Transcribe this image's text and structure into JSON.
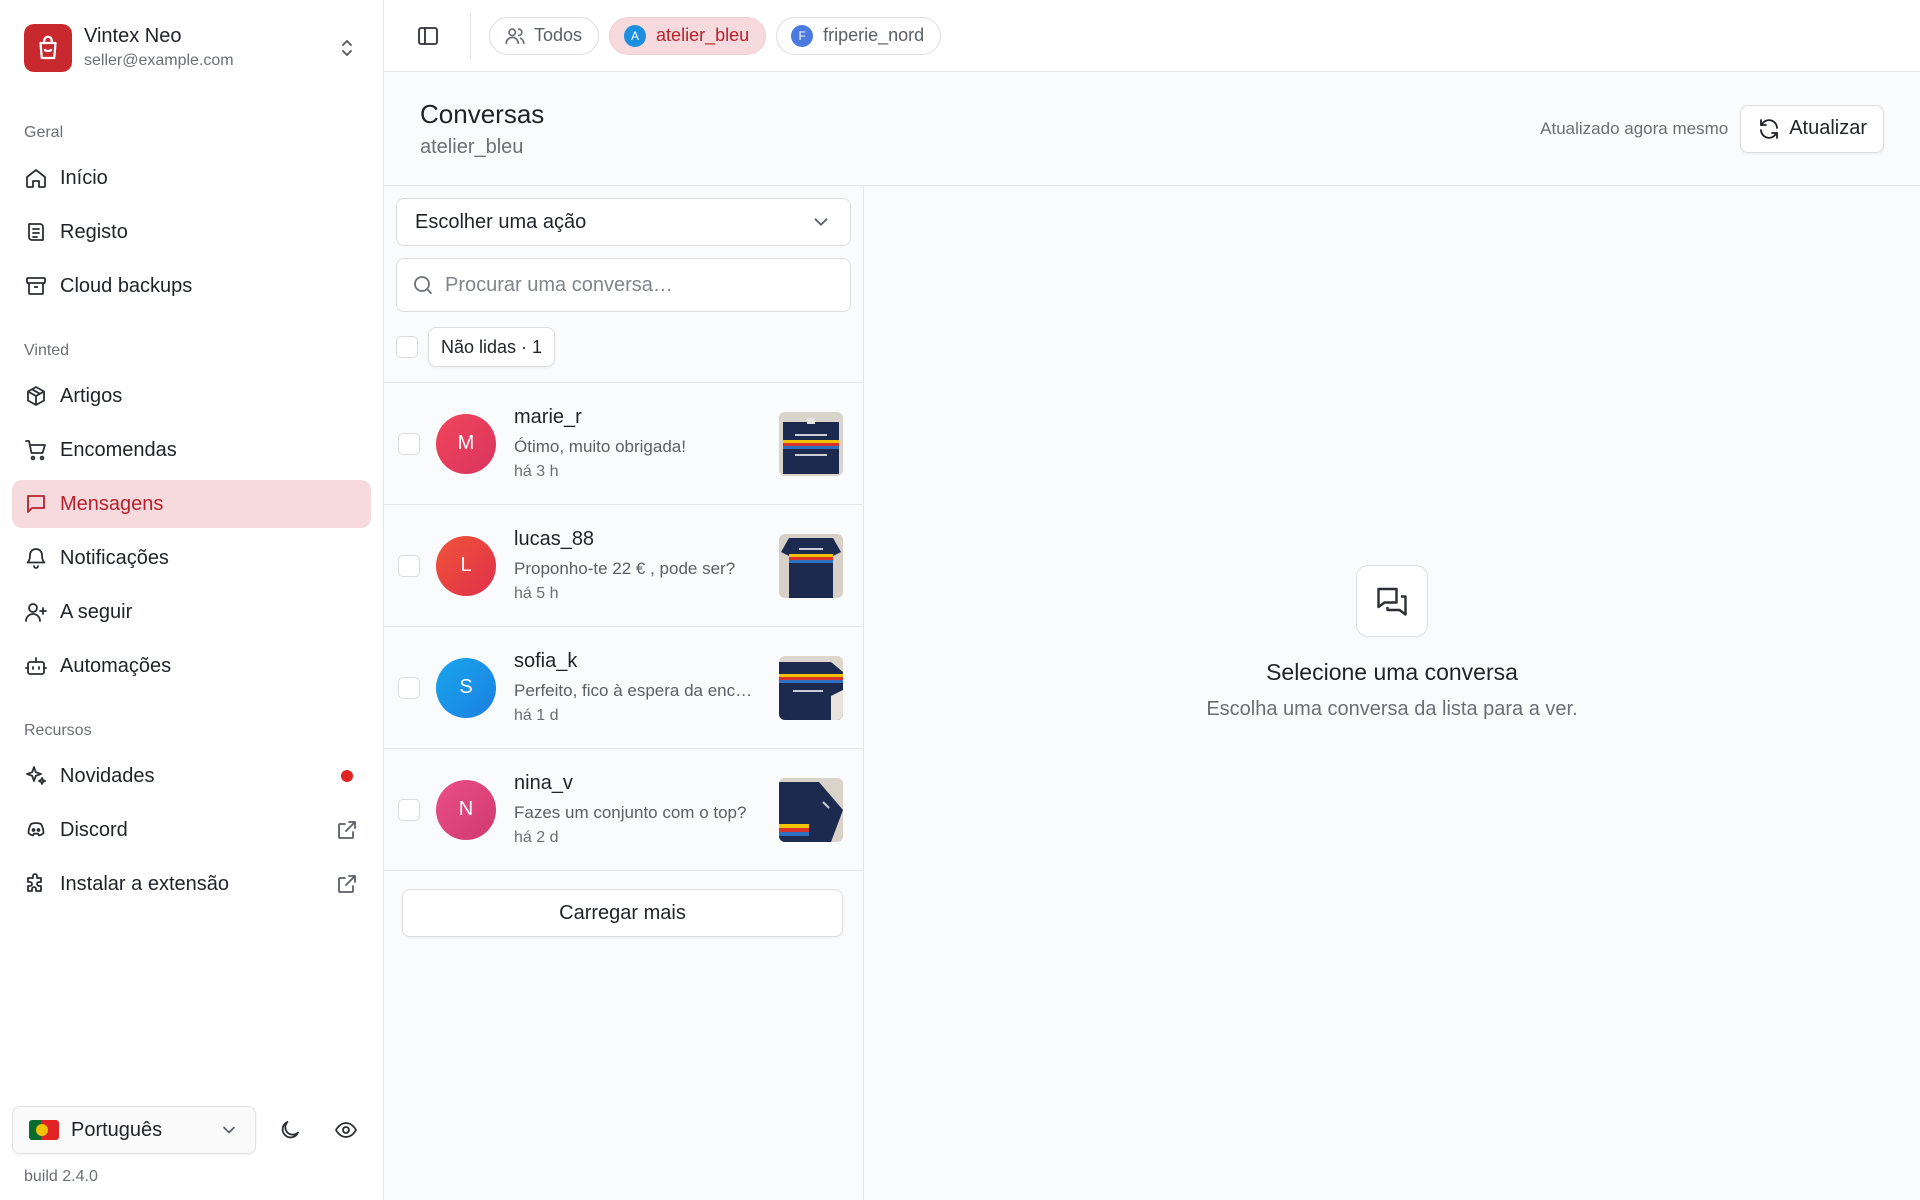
{
  "account": {
    "name": "Vintex Neo",
    "email": "seller@example.com"
  },
  "sidebar": {
    "sections": [
      {
        "label": "Geral"
      },
      {
        "label": "Vinted"
      },
      {
        "label": "Recursos"
      }
    ],
    "items": [
      {
        "label": "Início",
        "icon": "home-icon"
      },
      {
        "label": "Registo",
        "icon": "log-icon"
      },
      {
        "label": "Cloud backups",
        "icon": "archive-icon"
      },
      {
        "label": "Artigos",
        "icon": "package-icon"
      },
      {
        "label": "Encomendas",
        "icon": "cart-icon"
      },
      {
        "label": "Mensagens",
        "icon": "message-icon",
        "active": true
      },
      {
        "label": "Notificações",
        "icon": "bell-icon"
      },
      {
        "label": "A seguir",
        "icon": "user-plus-icon"
      },
      {
        "label": "Automações",
        "icon": "bot-icon"
      },
      {
        "label": "Novidades",
        "icon": "sparkles-icon",
        "badge": "new-dot"
      },
      {
        "label": "Discord",
        "icon": "discord-icon",
        "external": true
      },
      {
        "label": "Instalar a extensão",
        "icon": "puzzle-icon",
        "external": true
      }
    ],
    "language": "Português",
    "build": "build 2.4.0"
  },
  "topbar": {
    "filters": [
      {
        "label": "Todos",
        "icon": "users-icon"
      },
      {
        "label": "atelier_bleu",
        "avatar": "A",
        "avatar_color": "#1d8fe0",
        "active": true
      },
      {
        "label": "friperie_nord",
        "avatar": "F",
        "avatar_color": "#4b7be0"
      }
    ]
  },
  "header": {
    "title": "Conversas",
    "subtitle": "atelier_bleu",
    "status": "Atualizado agora mesmo",
    "refresh_label": "Atualizar"
  },
  "list": {
    "action_placeholder": "Escolher uma ação",
    "search_placeholder": "Procurar uma conversa…",
    "unread_filter": "Não lidas · 1",
    "conversations": [
      {
        "name": "marie_r",
        "message": "Ótimo, muito obrigada!",
        "time": "há 3 h",
        "initial": "M",
        "color_from": "#f0465a",
        "color_to": "#d9345f"
      },
      {
        "name": "lucas_88",
        "message": "Proponho-te 22 € , pode ser?",
        "time": "há 5 h",
        "initial": "L",
        "color_from": "#f0543a",
        "color_to": "#e0304a"
      },
      {
        "name": "sofia_k",
        "message": "Perfeito, fico à espera da encomenda",
        "time": "há 1 d",
        "initial": "S",
        "color_from": "#1aa6ee",
        "color_to": "#1a7fe0"
      },
      {
        "name": "nina_v",
        "message": "Fazes um conjunto com o top?",
        "time": "há 2 d",
        "initial": "N",
        "color_from": "#ea4f86",
        "color_to": "#cf3a6e"
      }
    ],
    "load_more": "Carregar mais"
  },
  "detail": {
    "empty_title": "Selecione uma conversa",
    "empty_subtitle": "Escolha uma conversa da lista para a ver."
  },
  "colors": {
    "brand": "#c8292f",
    "active_bg": "#f6dadd",
    "active_text": "#b8202b"
  }
}
